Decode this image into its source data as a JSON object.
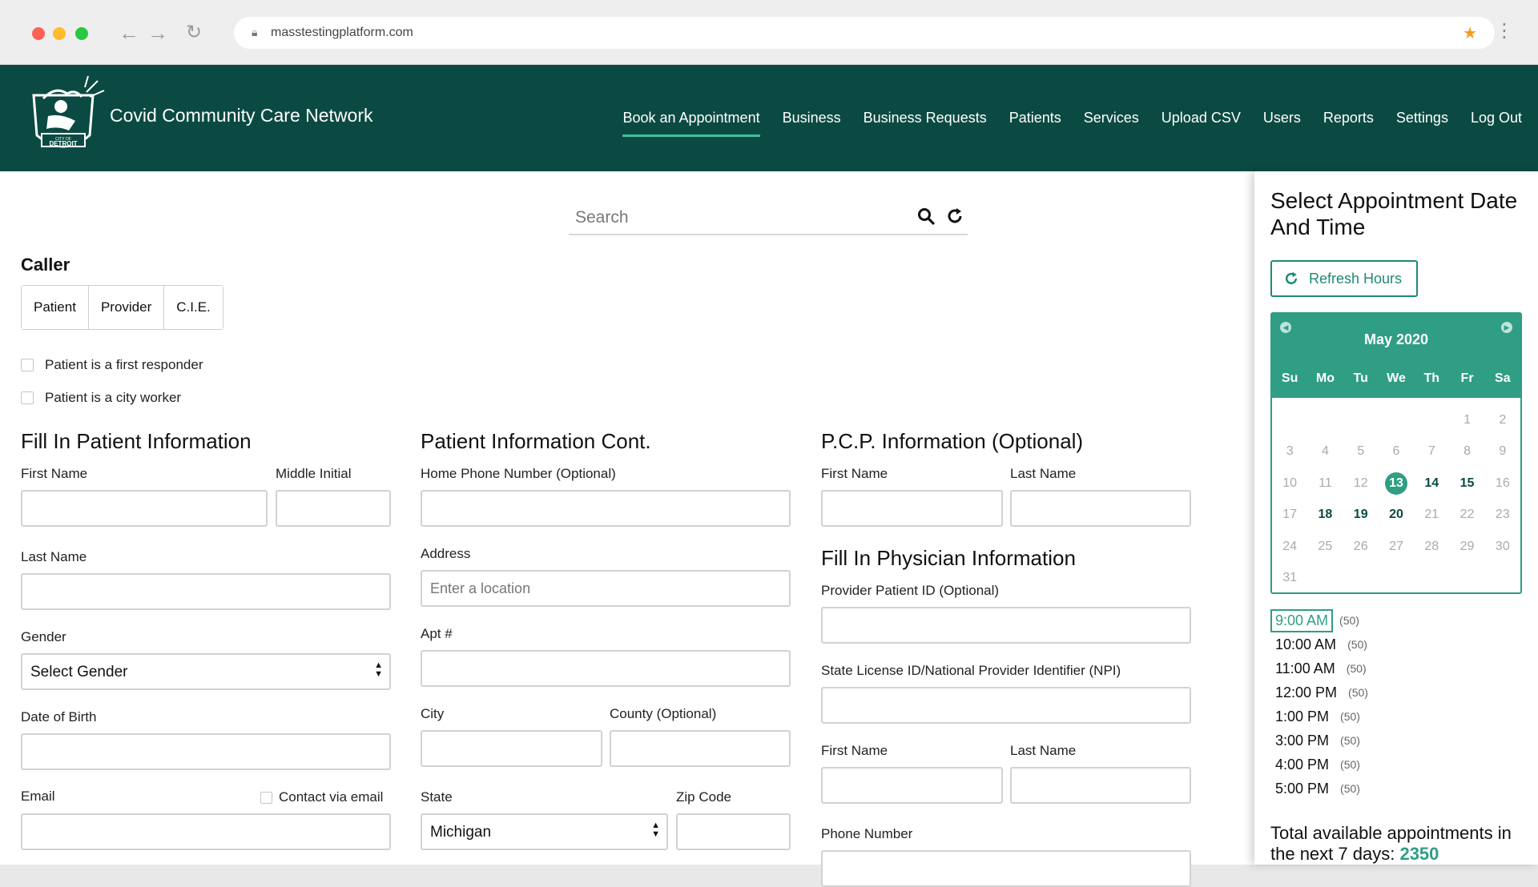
{
  "browser": {
    "url": "masstestingplatform.com"
  },
  "header": {
    "logo_text": "CITY OF DETROIT",
    "app_title": "Covid Community Care Network",
    "nav": [
      {
        "label": "Book an Appointment",
        "active": true
      },
      {
        "label": "Business"
      },
      {
        "label": "Business Requests"
      },
      {
        "label": "Patients"
      },
      {
        "label": "Services"
      },
      {
        "label": "Upload CSV"
      },
      {
        "label": "Users"
      },
      {
        "label": "Reports"
      },
      {
        "label": "Settings"
      },
      {
        "label": "Log Out"
      }
    ]
  },
  "search": {
    "placeholder": "Search"
  },
  "caller": {
    "title": "Caller",
    "options": [
      "Patient",
      "Provider",
      "C.I.E."
    ],
    "first_responder": "Patient is a first responder",
    "city_worker": "Patient is a city worker"
  },
  "patient_info": {
    "title": "Fill In Patient Information",
    "first_name": "First Name",
    "middle_initial": "Middle Initial",
    "last_name": "Last Name",
    "gender": "Gender",
    "gender_value": "Select Gender",
    "dob": "Date of Birth",
    "email": "Email",
    "contact_email": "Contact via email"
  },
  "patient_cont": {
    "title": "Patient Information Cont.",
    "home_phone": "Home Phone Number (Optional)",
    "address": "Address",
    "address_placeholder": "Enter a location",
    "apt": "Apt #",
    "city": "City",
    "county": "County (Optional)",
    "state": "State",
    "state_value": "Michigan",
    "zip": "Zip Code"
  },
  "pcp": {
    "title": "P.C.P. Information (Optional)",
    "first_name": "First Name",
    "last_name": "Last Name"
  },
  "physician": {
    "title": "Fill In Physician Information",
    "provider_id": "Provider Patient ID (Optional)",
    "npi": "State License ID/National Provider Identifier (NPI)",
    "first_name": "First Name",
    "last_name": "Last Name",
    "phone": "Phone Number"
  },
  "sidepanel": {
    "title": "Select Appointment Date And Time",
    "refresh_label": "Refresh Hours",
    "calendar": {
      "month": "May 2020",
      "dows": [
        "Su",
        "Mo",
        "Tu",
        "We",
        "Th",
        "Fr",
        "Sa"
      ],
      "weeks": [
        [
          "",
          "",
          "",
          "",
          "",
          "1",
          "2"
        ],
        [
          "3",
          "4",
          "5",
          "6",
          "7",
          "8",
          "9"
        ],
        [
          "10",
          "11",
          "12",
          "13",
          "14",
          "15",
          "16"
        ],
        [
          "17",
          "18",
          "19",
          "20",
          "21",
          "22",
          "23"
        ],
        [
          "24",
          "25",
          "26",
          "27",
          "28",
          "29",
          "30"
        ],
        [
          "31",
          "",
          "",
          "",
          "",
          "",
          ""
        ]
      ],
      "selected": "13",
      "available": [
        "14",
        "15",
        "18",
        "19",
        "20"
      ]
    },
    "times": [
      {
        "time": "9:00 AM",
        "count": "(50)",
        "selected": true
      },
      {
        "time": "10:00 AM",
        "count": "(50)"
      },
      {
        "time": "11:00 AM",
        "count": "(50)"
      },
      {
        "time": "12:00 PM",
        "count": "(50)"
      },
      {
        "time": "1:00 PM",
        "count": "(50)"
      },
      {
        "time": "3:00 PM",
        "count": "(50)"
      },
      {
        "time": "4:00 PM",
        "count": "(50)"
      },
      {
        "time": "5:00 PM",
        "count": "(50)"
      }
    ],
    "total_label": "Total available appointments in the next 7 days:",
    "total_value": "2350"
  },
  "colors": {
    "header_bg": "#0b4a42",
    "accent": "#2f9e85",
    "nav_underline": "#3dbf9e"
  }
}
